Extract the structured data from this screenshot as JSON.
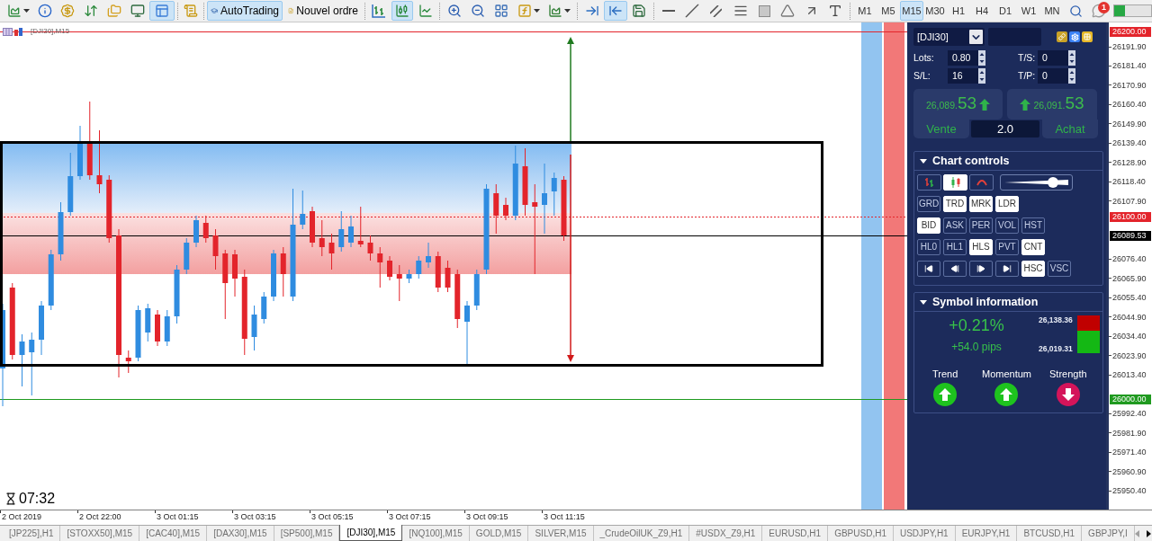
{
  "toolbar": {
    "file_buttons": [
      {
        "selected": false
      },
      {
        "selected": false
      },
      {
        "selected": false
      },
      {
        "selected": false
      },
      {
        "selected": false
      },
      {
        "selected": false
      },
      {
        "selected": true
      }
    ],
    "autotrading": {
      "label": "AutoTrading",
      "selected": true
    },
    "new_order": {
      "label": "Nouvel ordre"
    },
    "chart_type_buttons": [
      {
        "selected": false
      },
      {
        "selected": true
      },
      {
        "selected": false
      }
    ],
    "scroll_buttons": [
      {
        "selected": false
      },
      {
        "selected": true
      },
      {
        "selected": false
      }
    ],
    "timeframes": [
      {
        "label": "M1",
        "selected": false
      },
      {
        "label": "M5",
        "selected": false
      },
      {
        "label": "M15",
        "selected": true
      },
      {
        "label": "M30",
        "selected": false
      },
      {
        "label": "H1",
        "selected": false
      },
      {
        "label": "H4",
        "selected": false
      },
      {
        "label": "D1",
        "selected": false
      },
      {
        "label": "W1",
        "selected": false
      },
      {
        "label": "MN",
        "selected": false
      }
    ],
    "notification_count": "1"
  },
  "chart": {
    "title": "[DJI30],M15",
    "timer": "07:32",
    "levels": [
      {
        "label": "26200.00",
        "color": "#e3242b",
        "kind": "solid"
      },
      {
        "label": "26100.00",
        "color": "#e3242b",
        "kind": "dotted"
      },
      {
        "label": "26089.53",
        "color": "#000000",
        "kind": "solid"
      },
      {
        "label": "26000.00",
        "color": "#1f9a1f",
        "kind": "solid"
      }
    ],
    "price_ticks": [
      "26191.90",
      "26181.40",
      "26170.90",
      "26160.40",
      "26149.90",
      "26139.40",
      "26128.90",
      "26118.40",
      "26107.90",
      "26076.40",
      "26065.90",
      "26055.40",
      "26044.90",
      "26034.40",
      "26023.90",
      "26013.40",
      "25992.40",
      "25981.90",
      "25971.40",
      "25960.90",
      "25950.40"
    ],
    "time_labels": [
      "2 Oct 2019",
      "2 Oct 22:00",
      "3 Oct 01:15",
      "3 Oct 03:15",
      "3 Oct 05:15",
      "3 Oct 07:15",
      "3 Oct 09:15",
      "3 Oct 11:15"
    ]
  },
  "trade_panel": {
    "symbol": "[DJI30]",
    "fields": [
      {
        "label": "Lots:",
        "value": "0.80"
      },
      {
        "label": "T/S:",
        "value": "0"
      },
      {
        "label": "S/L:",
        "value": "16"
      },
      {
        "label": "T/P:",
        "value": "0"
      }
    ],
    "sell": {
      "price": "26,089.",
      "pips": "53",
      "rising": true,
      "label": "Vente"
    },
    "buy": {
      "price": "26,091.",
      "pips": "53",
      "rising": true,
      "label": "Achat"
    },
    "volume": "2.0"
  },
  "chart_controls": {
    "title": "Chart controls",
    "expanded": true,
    "style_buttons": [
      {
        "selected": false
      },
      {
        "selected": true
      },
      {
        "selected": false
      }
    ],
    "zoom": {
      "level": 0.76
    },
    "toggle_rows": [
      [
        {
          "label": "GRD",
          "on": false
        },
        {
          "label": "TRD",
          "on": true
        },
        {
          "label": "MRK",
          "on": true
        },
        {
          "label": "LDR",
          "on": true
        }
      ],
      [
        {
          "label": "BID",
          "on": true
        },
        {
          "label": "ASK",
          "on": false
        },
        {
          "label": "PER",
          "on": false
        },
        {
          "label": "VOL",
          "on": false
        },
        {
          "label": "HST",
          "on": false
        }
      ],
      [
        {
          "label": "HL0",
          "on": false
        },
        {
          "label": "HL1",
          "on": false
        },
        {
          "label": "HLS",
          "on": true
        },
        {
          "label": "PVT",
          "on": false
        },
        {
          "label": "CNT",
          "on": true
        }
      ],
      [
        {
          "label": "HSC",
          "on": true
        },
        {
          "label": "VSC",
          "on": false
        }
      ]
    ]
  },
  "symbol_information": {
    "title": "Symbol information",
    "expanded": true,
    "change": "+0.21%",
    "pips": "+54.0 pips",
    "high": "26,138.36",
    "low": "26,019.31",
    "range": {
      "level": 0.6
    },
    "indicators": [
      {
        "label": "Trend",
        "kind": "up",
        "color": "#1ec31e"
      },
      {
        "label": "Momentum",
        "kind": "up",
        "color": "#1ec31e"
      },
      {
        "label": "Strength",
        "kind": "down",
        "color": "#d4145a"
      }
    ]
  },
  "tabs": [
    {
      "label": "[JP225],H1",
      "selected": false
    },
    {
      "label": "[STOXX50],M15",
      "selected": false
    },
    {
      "label": "[CAC40],M15",
      "selected": false
    },
    {
      "label": "[DAX30],M15",
      "selected": false
    },
    {
      "label": "[SP500],M15",
      "selected": false
    },
    {
      "label": "[DJI30],M15",
      "selected": true
    },
    {
      "label": "[NQ100],M15",
      "selected": false
    },
    {
      "label": "GOLD,M15",
      "selected": false
    },
    {
      "label": "SILVER,M15",
      "selected": false
    },
    {
      "label": "_CrudeOilUK_Z9,H1",
      "selected": false
    },
    {
      "label": "#USDX_Z9,H1",
      "selected": false
    },
    {
      "label": "EURUSD,H1",
      "selected": false
    },
    {
      "label": "GBPUSD,H1",
      "selected": false
    },
    {
      "label": "USDJPY,H1",
      "selected": false
    },
    {
      "label": "EURJPY,H1",
      "selected": false
    },
    {
      "label": "BTCUSD,H1",
      "selected": false
    },
    {
      "label": "GBPJPY,I",
      "selected": false
    }
  ],
  "tab_scroll": [
    {
      "disabled": true
    },
    {
      "disabled": false
    }
  ]
}
